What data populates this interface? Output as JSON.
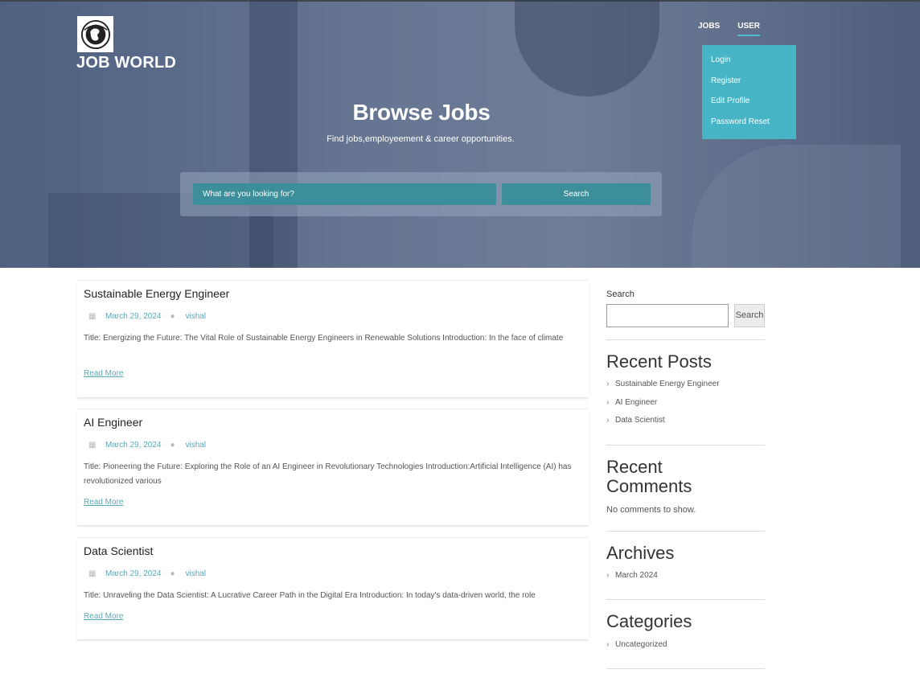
{
  "header": {
    "site_title": "JOB WORLD",
    "logo_icon": "globe-emblem-icon",
    "nav": [
      {
        "label": "JOBS"
      },
      {
        "label": "USER"
      }
    ],
    "user_menu": [
      "Login",
      "Register",
      "Edit Profile",
      "Password Reset"
    ]
  },
  "hero": {
    "title": "Browse Jobs",
    "subtitle": "Find jobs,employeement & career opportunities.",
    "search_placeholder": "What are you looking for?",
    "search_button": "Search"
  },
  "posts": [
    {
      "title": "Sustainable Energy Engineer",
      "date": "March 29, 2024",
      "author": "vishal",
      "excerpt": "Title: Energizing the Future: The Vital Role of Sustainable Energy Engineers in Renewable Solutions Introduction: In the face of climate",
      "read_more": "Read More"
    },
    {
      "title": "AI Engineer",
      "date": "March 29, 2024",
      "author": "vishal",
      "excerpt": "Title: Pioneering the Future: Exploring the Role of an AI Engineer in Revolutionary Technologies Introduction:Artificial Intelligence (AI) has revolutionized various",
      "read_more": "Read More"
    },
    {
      "title": "Data Scientist",
      "date": "March 29, 2024",
      "author": "vishal",
      "excerpt": "Title: Unraveling the Data Scientist: A Lucrative Career Path in the Digital Era Introduction: In today's data-driven world, the role",
      "read_more": "Read More"
    }
  ],
  "sidebar": {
    "search_label": "Search",
    "search_button": "Search",
    "recent_posts_title": "Recent Posts",
    "recent_posts": [
      "Sustainable Energy Engineer",
      "AI Engineer",
      "Data Scientist"
    ],
    "recent_comments_title": "Recent Comments",
    "no_comments": "No comments to show.",
    "archives_title": "Archives",
    "archives": [
      "March 2024"
    ],
    "categories_title": "Categories",
    "categories": [
      "Uncategorized"
    ]
  },
  "colors": {
    "accent": "#47b5c5",
    "search_field": "#3c8f9a",
    "link": "#5aa9bc"
  }
}
